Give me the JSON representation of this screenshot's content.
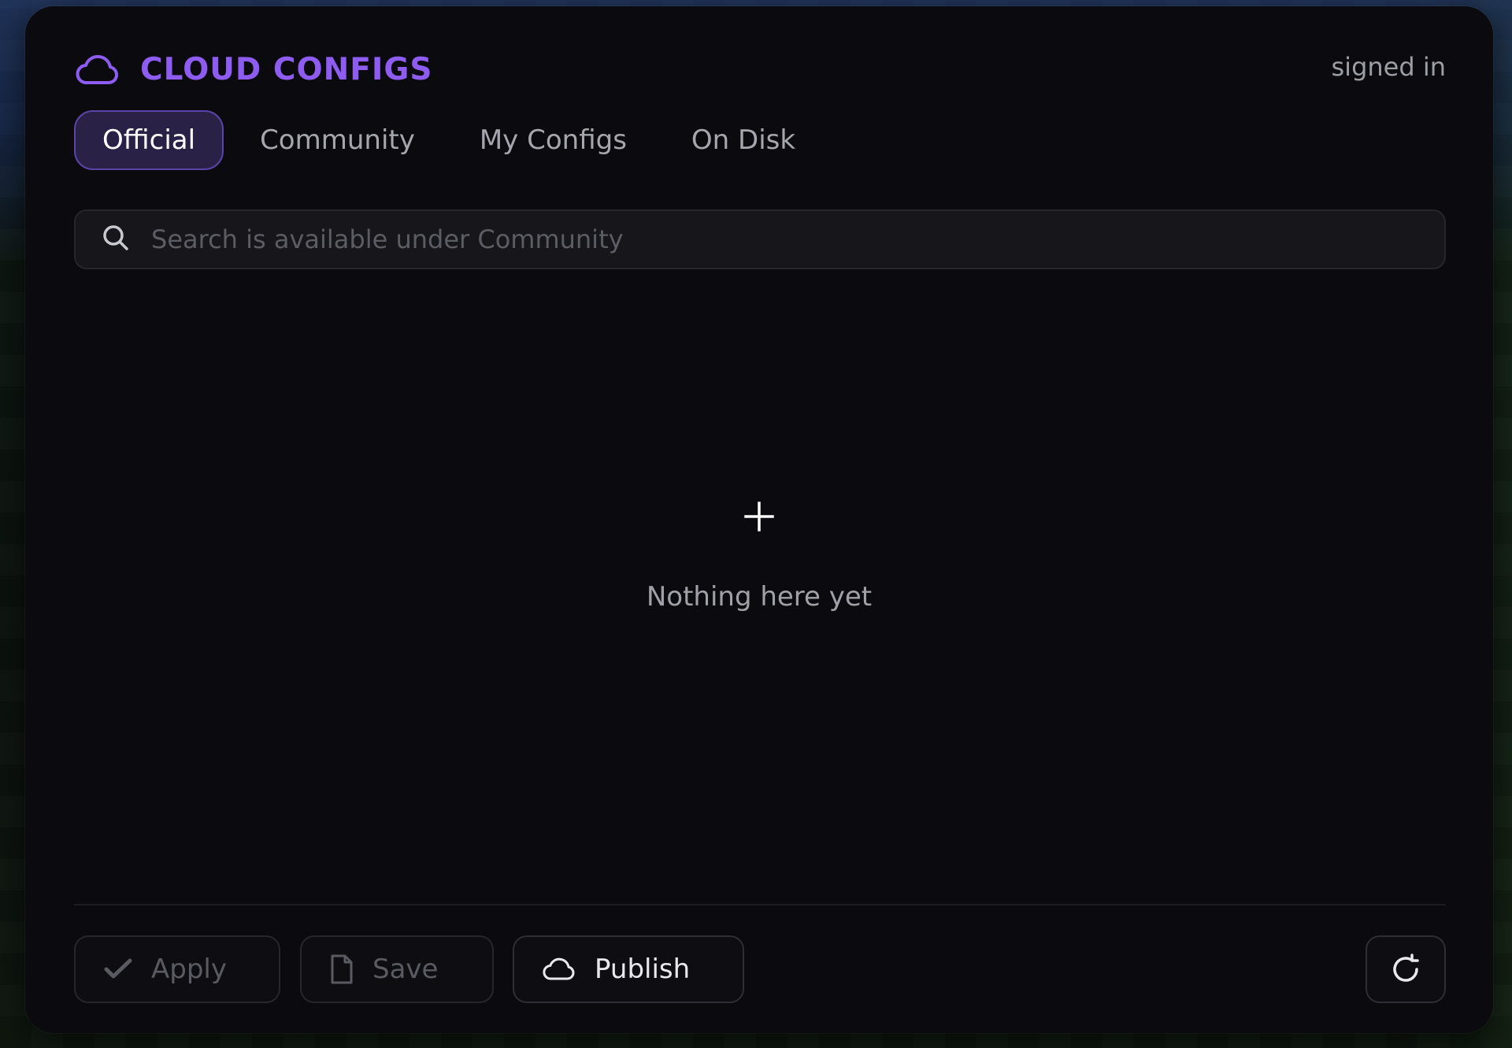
{
  "header": {
    "icon": "cloud-icon",
    "title": "CLOUD CONFIGS",
    "status": "signed in",
    "accent_color": "#8e5cf0"
  },
  "tabs": [
    {
      "label": "Official",
      "active": true
    },
    {
      "label": "Community",
      "active": false
    },
    {
      "label": "My Configs",
      "active": false
    },
    {
      "label": "On Disk",
      "active": false
    }
  ],
  "search": {
    "icon": "search-icon",
    "value": "",
    "placeholder": "Search is available under Community",
    "disabled": true
  },
  "empty_state": {
    "icon": "plus-icon",
    "text": "Nothing here yet"
  },
  "footer": {
    "apply": {
      "label": "Apply",
      "icon": "check-icon",
      "enabled": false
    },
    "save": {
      "label": "Save",
      "icon": "file-icon",
      "enabled": false
    },
    "publish": {
      "label": "Publish",
      "icon": "cloud-icon",
      "enabled": true
    },
    "refresh": {
      "icon": "refresh-icon",
      "enabled": true
    }
  }
}
